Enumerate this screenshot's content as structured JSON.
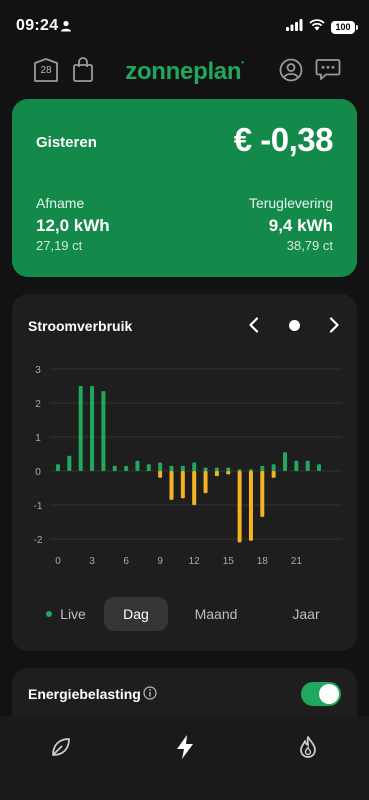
{
  "status_bar": {
    "time": "09:24",
    "battery": "100"
  },
  "header": {
    "calendar_day": "28",
    "logo": "zonneplan"
  },
  "summary": {
    "period_label": "Gisteren",
    "amount": "€ -0,38",
    "afname": {
      "label": "Afname",
      "value": "12,0 kWh",
      "price": "27,19 ct"
    },
    "teruglevering": {
      "label": "Teruglevering",
      "value": "9,4 kWh",
      "price": "38,79 ct"
    }
  },
  "chart_card": {
    "title": "Stroomverbruik"
  },
  "chart_data": {
    "type": "bar",
    "title": "Stroomverbruik",
    "x_ticks": [
      "0",
      "3",
      "6",
      "9",
      "12",
      "15",
      "18",
      "21"
    ],
    "y_ticks": [
      "3",
      "2",
      "1",
      "0",
      "-1",
      "-2"
    ],
    "ylim": [
      -2.2,
      3
    ],
    "hours": [
      0,
      1,
      2,
      3,
      4,
      5,
      6,
      7,
      8,
      9,
      10,
      11,
      12,
      13,
      14,
      15,
      16,
      17,
      18,
      19,
      20,
      21,
      22,
      23
    ],
    "series": [
      {
        "values": [
          0.2,
          0.45,
          2.5,
          2.5,
          2.35,
          0.15,
          0.15,
          0.3,
          0.2,
          0.25,
          0.15,
          0.15,
          0.25,
          0.1,
          0.1,
          0.1,
          0.05,
          0.05,
          0.15,
          0.2,
          0.55,
          0.3,
          0.3,
          0.2
        ],
        "color": "#1fa85e"
      },
      {
        "values": [
          0,
          0,
          0,
          0,
          0,
          0,
          0,
          0,
          0,
          -0.2,
          -0.85,
          -0.8,
          -1.0,
          -0.65,
          -0.15,
          -0.1,
          -2.1,
          -2.05,
          -1.35,
          -0.2,
          0,
          0,
          0,
          0
        ],
        "color": "#f5b321"
      }
    ],
    "grid": true
  },
  "tabs": {
    "live": "Live",
    "dag": "Dag",
    "maand": "Maand",
    "jaar": "Jaar"
  },
  "energy_tax": {
    "label": "Energiebelasting",
    "enabled": true
  },
  "bottom_nav": [
    "leaf-icon",
    "lightning-icon",
    "flame-icon"
  ]
}
